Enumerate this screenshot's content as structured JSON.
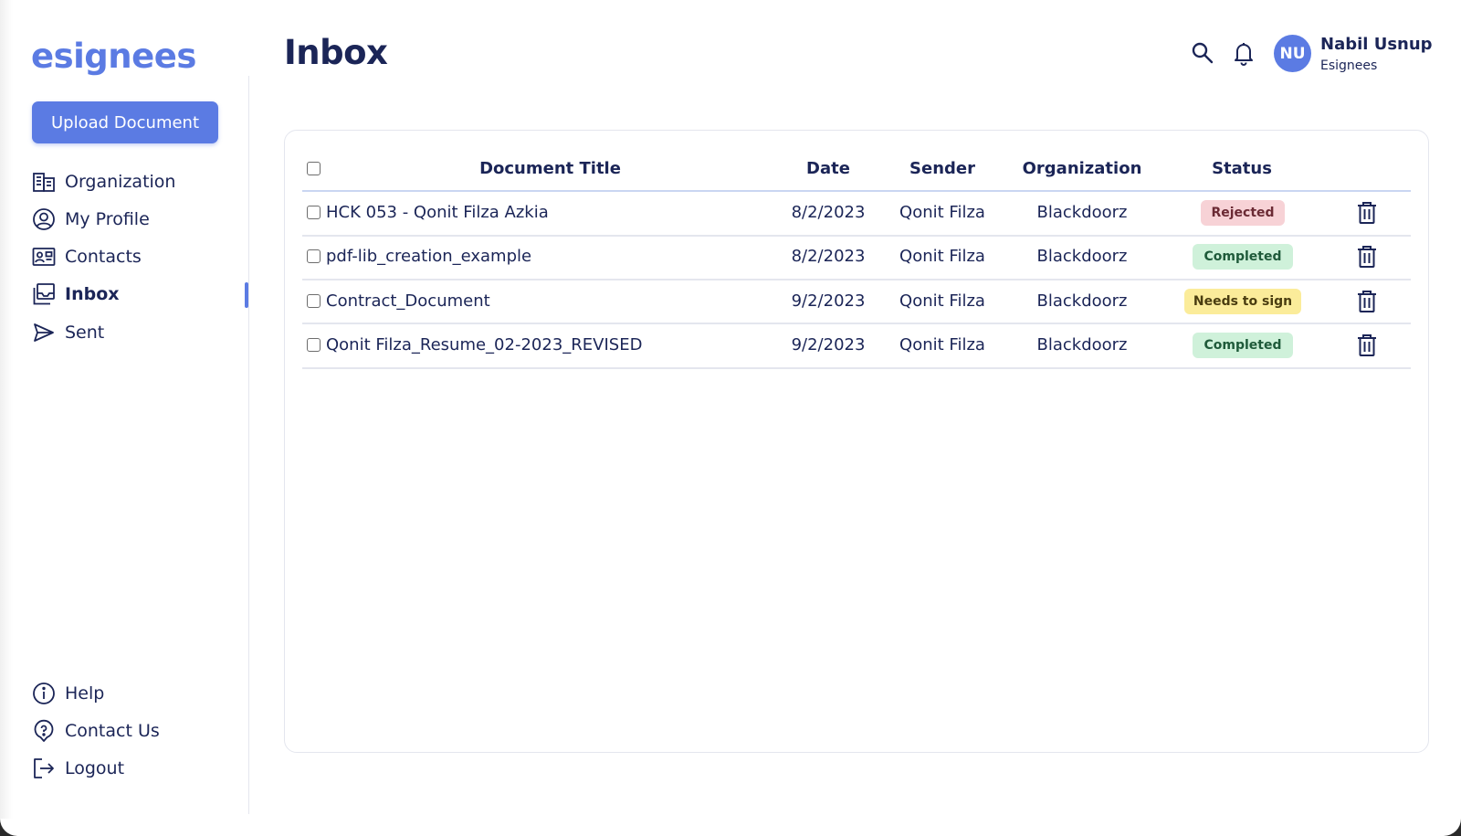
{
  "app": {
    "logo": "esignees",
    "accent_color": "#5b7be3",
    "text_color": "#1b2557"
  },
  "sidebar": {
    "upload_label": "Upload Document",
    "items": [
      {
        "label": "Organization",
        "icon": "organization-icon",
        "active": false
      },
      {
        "label": "My Profile",
        "icon": "profile-icon",
        "active": false
      },
      {
        "label": "Contacts",
        "icon": "contacts-icon",
        "active": false
      },
      {
        "label": "Inbox",
        "icon": "inbox-icon",
        "active": true
      },
      {
        "label": "Sent",
        "icon": "send-icon",
        "active": false
      }
    ],
    "bottom_items": [
      {
        "label": "Help",
        "icon": "info-icon"
      },
      {
        "label": "Contact Us",
        "icon": "support-icon"
      },
      {
        "label": "Logout",
        "icon": "logout-icon"
      }
    ]
  },
  "header": {
    "title": "Inbox",
    "search_icon": "search-icon",
    "notification_icon": "bell-icon",
    "user": {
      "initials": "NU",
      "name": "Nabil Usnup",
      "organization": "Esignees"
    }
  },
  "table": {
    "columns": [
      "Document Title",
      "Date",
      "Sender",
      "Organization",
      "Status"
    ],
    "rows": [
      {
        "title": "HCK 053 - Qonit Filza Azkia",
        "date": "8/2/2023",
        "sender": "Qonit Filza",
        "organization": "Blackdoorz",
        "status": "Rejected",
        "status_bg": "#f7d2d6",
        "status_fg": "#6b2a34",
        "checked": false
      },
      {
        "title": "pdf-lib_creation_example",
        "date": "8/2/2023",
        "sender": "Qonit Filza",
        "organization": "Blackdoorz",
        "status": "Completed",
        "status_bg": "#cff1da",
        "status_fg": "#1f5a3a",
        "checked": false
      },
      {
        "title": "Contract_Document",
        "date": "9/2/2023",
        "sender": "Qonit Filza",
        "organization": "Blackdoorz",
        "status": "Needs to sign",
        "status_bg": "#fbec9a",
        "status_fg": "#4a3d10",
        "checked": false
      },
      {
        "title": "Qonit Filza_Resume_02-2023_REVISED",
        "date": "9/2/2023",
        "sender": "Qonit Filza",
        "organization": "Blackdoorz",
        "status": "Completed",
        "status_bg": "#cff1da",
        "status_fg": "#1f5a3a",
        "checked": false
      }
    ],
    "row_action_icon": "trash-icon"
  }
}
